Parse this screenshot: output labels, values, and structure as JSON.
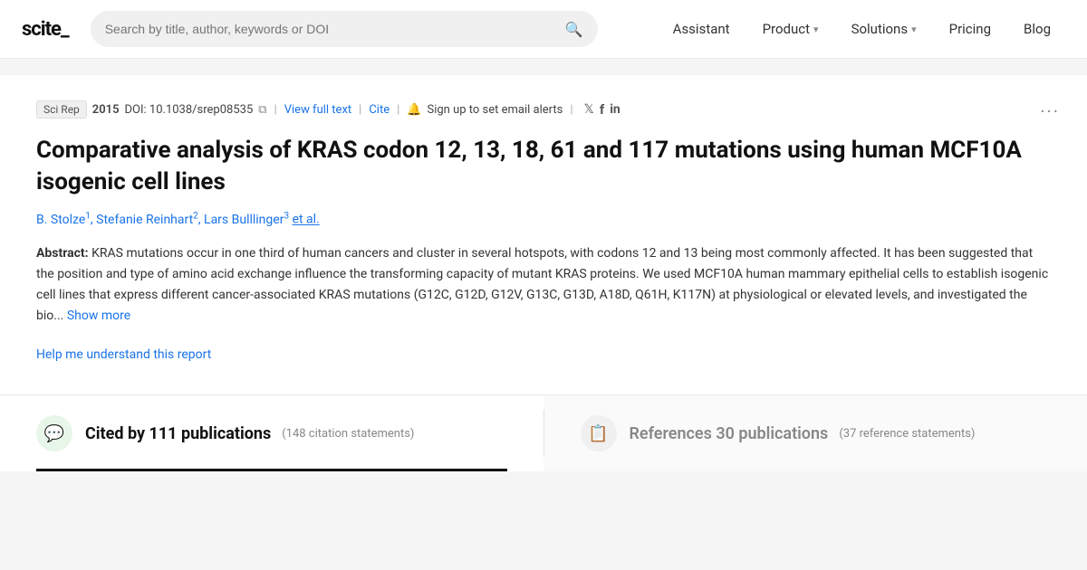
{
  "logo": {
    "text": "scite_"
  },
  "search": {
    "placeholder": "Search by title, author, keywords or DOI"
  },
  "nav": {
    "links": [
      {
        "label": "Assistant",
        "has_chevron": false
      },
      {
        "label": "Product",
        "has_chevron": true
      },
      {
        "label": "Solutions",
        "has_chevron": true
      },
      {
        "label": "Pricing",
        "has_chevron": false
      },
      {
        "label": "Blog",
        "has_chevron": false
      }
    ]
  },
  "paper": {
    "journal": "Sci Rep",
    "year": "2015",
    "doi": "DOI: 10.1038/srep08535",
    "view_full_text": "View full text",
    "cite": "Cite",
    "alerts": "Sign up to set email alerts",
    "title": "Comparative analysis of KRAS codon 12, 13, 18, 61 and 117 mutations using human MCF10A isogenic cell lines",
    "authors": [
      {
        "name": "B. Stolze",
        "superscript": "1"
      },
      {
        "name": "Stefanie Reinhart",
        "superscript": "2"
      },
      {
        "name": "Lars Bulllinger",
        "superscript": "3"
      }
    ],
    "et_al": "et al.",
    "abstract_label": "Abstract:",
    "abstract_text": "KRAS mutations occur in one third of human cancers and cluster in several hotspots, with codons 12 and 13 being most commonly affected. It has been suggested that the position and type of amino acid exchange influence the transforming capacity of mutant KRAS proteins. We used MCF10A human mammary epithelial cells to establish isogenic cell lines that express different cancer-associated KRAS mutations (G12C, G12D, G12V, G13C, G13D, A18D, Q61H, K117N) at physiological or elevated levels, and investigated the bio...",
    "show_more": "Show more",
    "help_link": "Help me understand this report",
    "more_btn": "···"
  },
  "stats": {
    "cited": {
      "icon": "💬",
      "main": "Cited by 111 publications",
      "sub": "(148 citation statements)",
      "active": true
    },
    "references": {
      "icon": "📋",
      "main": "References 30 publications",
      "sub": "(37 reference statements)",
      "active": false
    }
  }
}
